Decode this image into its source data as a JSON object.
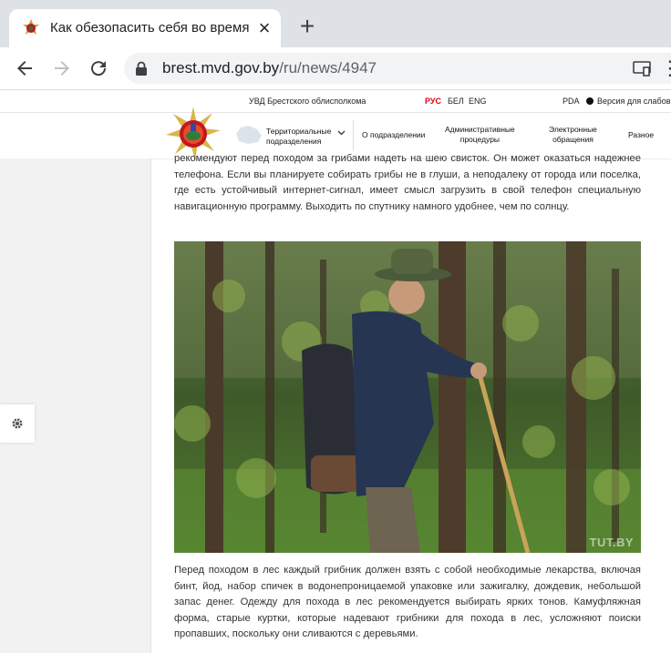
{
  "browser": {
    "tab_title": "Как обезопасить себя во время",
    "url_host": "brest.mvd.gov.by",
    "url_path": "/ru/news/4947"
  },
  "site": {
    "org_name": "УВД Брестского облисполкома",
    "langs": [
      "РУС",
      "БЕЛ",
      "ENG"
    ],
    "pda": "PDA",
    "accessibility": "Версия для слабовид",
    "nav": {
      "territorial_1": "Территориальные",
      "territorial_2": "подразделения",
      "about": "О подразделении",
      "admin_1": "Административные",
      "admin_2": "процедуры",
      "elec_1": "Электронные",
      "elec_2": "обращения",
      "misc": "Разное"
    }
  },
  "article": {
    "para_top": "рекомендуют перед походом за грибами надеть на шею свисток. Он может оказаться надежнее телефона. Если вы планируете собирать грибы не в глуши, а неподалеку от города или поселка, где есть устойчивый интернет-сигнал, имеет смысл загрузить в свой телефон специальную навигационную программу. Выходить по спутнику намного удобнее, чем по солнцу.",
    "photo_watermark": "TUT.BY",
    "para_bottom": "Перед походом в лес каждый грибник должен взять с собой необходимые лекарства, включая бинт, йод, набор спичек в водонепроницаемой упаковке или зажигалку, дождевик, небольшой запас денег. Одежду для похода в лес рекомендуется выбирать ярких тонов. Камуфляжная форма, старые куртки, которые надевают грибники для похода в лес, усложняют поиски пропавших, поскольку они сливаются с деревьями."
  }
}
